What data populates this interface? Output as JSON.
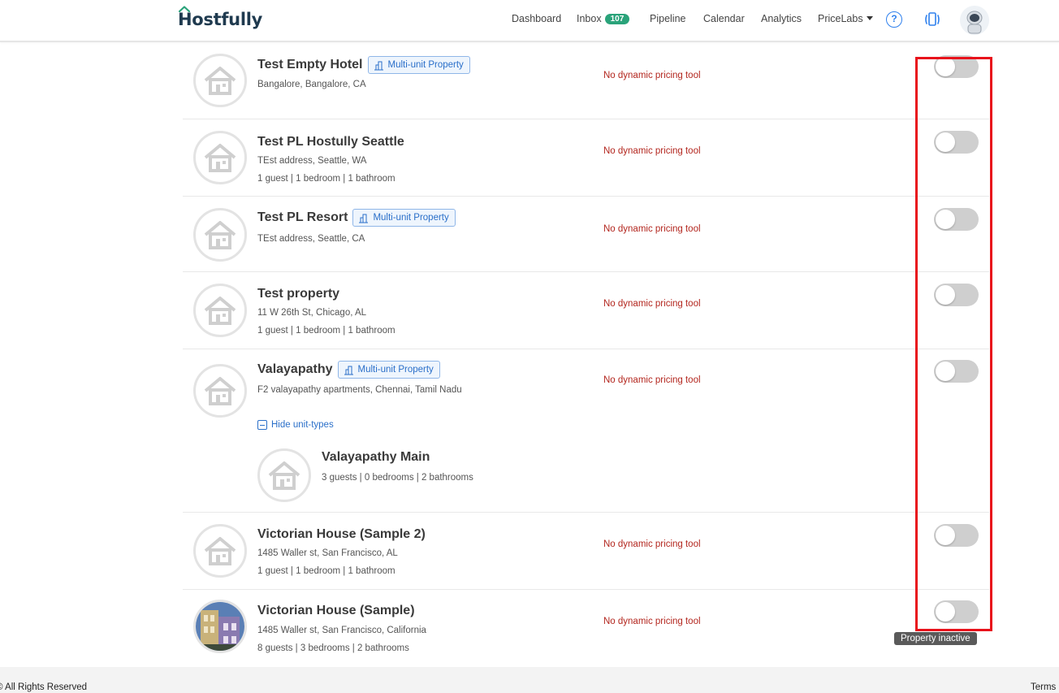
{
  "header": {
    "logo": "Hostfully",
    "nav": {
      "dashboard": "Dashboard",
      "inbox": "Inbox",
      "inbox_count": "107",
      "pipeline": "Pipeline",
      "calendar": "Calendar",
      "analytics": "Analytics",
      "pricelabs": "PriceLabs"
    },
    "help_glyph": "?"
  },
  "properties": [
    {
      "name": "Test Empty Hotel",
      "badge": "Multi-unit Property",
      "address": "Bangalore, Bangalore, CA",
      "details": "",
      "tool": "No dynamic pricing tool",
      "active": false
    },
    {
      "name": "Test PL Hostully Seattle",
      "badge": "",
      "address": "TEst address, Seattle, WA",
      "details": "1 guest | 1 bedroom | 1 bathroom",
      "tool": "No dynamic pricing tool",
      "active": false
    },
    {
      "name": "Test PL Resort",
      "badge": "Multi-unit Property",
      "address": "TEst address, Seattle, CA",
      "details": "",
      "tool": "No dynamic pricing tool",
      "active": false
    },
    {
      "name": "Test property",
      "badge": "",
      "address": "11 W 26th St, Chicago, AL",
      "details": "1 guest | 1 bedroom | 1 bathroom",
      "tool": "No dynamic pricing tool",
      "active": false
    },
    {
      "name": "Valayapathy",
      "badge": "Multi-unit Property",
      "address": "F2 valayapathy apartments, Chennai, Tamil Nadu",
      "details": "",
      "tool": "No dynamic pricing tool",
      "active": false,
      "hide_label": "Hide unit-types",
      "unit": {
        "name": "Valayapathy Main",
        "details": "3 guests | 0 bedrooms | 2 bathrooms"
      }
    },
    {
      "name": "Victorian House (Sample 2)",
      "badge": "",
      "address": "1485 Waller st, San Francisco, AL",
      "details": "1 guest | 1 bedroom | 1 bathroom",
      "tool": "No dynamic pricing tool",
      "active": false
    },
    {
      "name": "Victorian House (Sample)",
      "badge": "",
      "address": "1485 Waller st, San Francisco, California",
      "details": "8 guests | 3 bedrooms | 2 bathrooms",
      "tool": "No dynamic pricing tool",
      "active": false
    }
  ],
  "tooltip": "Property inactive",
  "footer": {
    "left": "© All Rights Reserved",
    "right": "Terms"
  },
  "colors": {
    "accent": "#2a6fc9",
    "warning_text": "#b3261e",
    "badge_green": "#2aa37a",
    "highlight": "#e8121b",
    "toggle_off": "#cfcfcf"
  }
}
